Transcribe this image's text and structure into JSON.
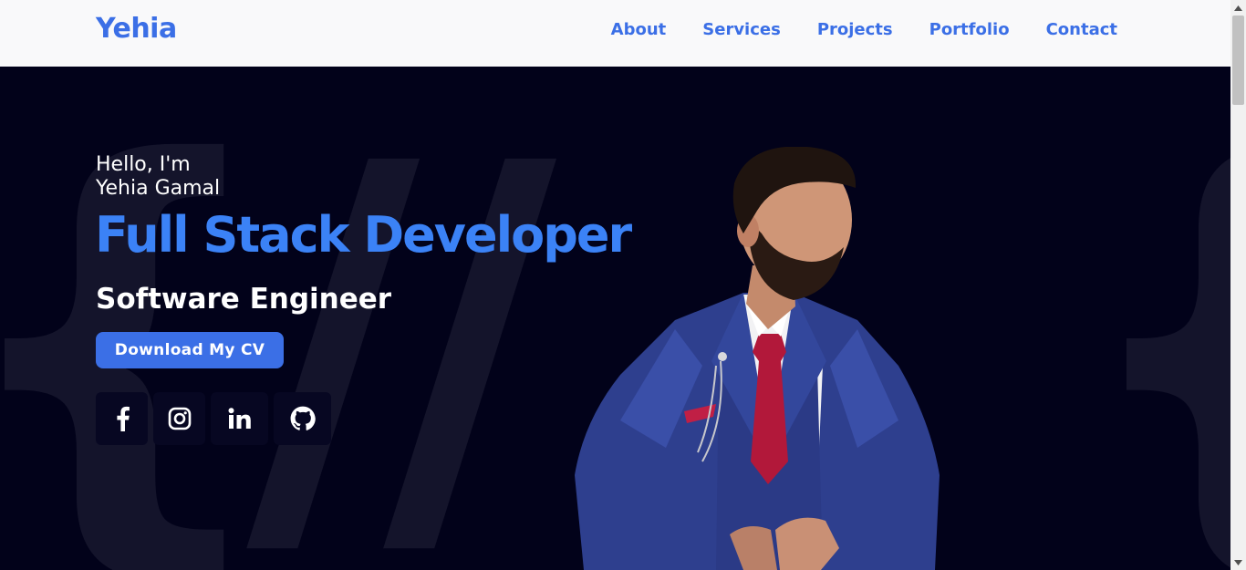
{
  "header": {
    "brand": "Yehia",
    "nav": [
      "About",
      "Services",
      "Projects",
      "Portfolio",
      "Contact"
    ]
  },
  "hero": {
    "greeting_line1": "Hello, I'm",
    "greeting_line2": "Yehia Gamal",
    "title": "Full Stack Developer",
    "subtitle": "Software Engineer",
    "cv_button": "Download My CV",
    "socials": [
      "facebook-icon",
      "instagram-icon",
      "linkedin-icon",
      "github-icon"
    ],
    "bg_left": "{//",
    "bg_right": "{"
  },
  "colors": {
    "accent": "#3b6fe6",
    "title": "#3b82f6",
    "background": "#02021a",
    "header_bg": "#f9f9fa"
  }
}
